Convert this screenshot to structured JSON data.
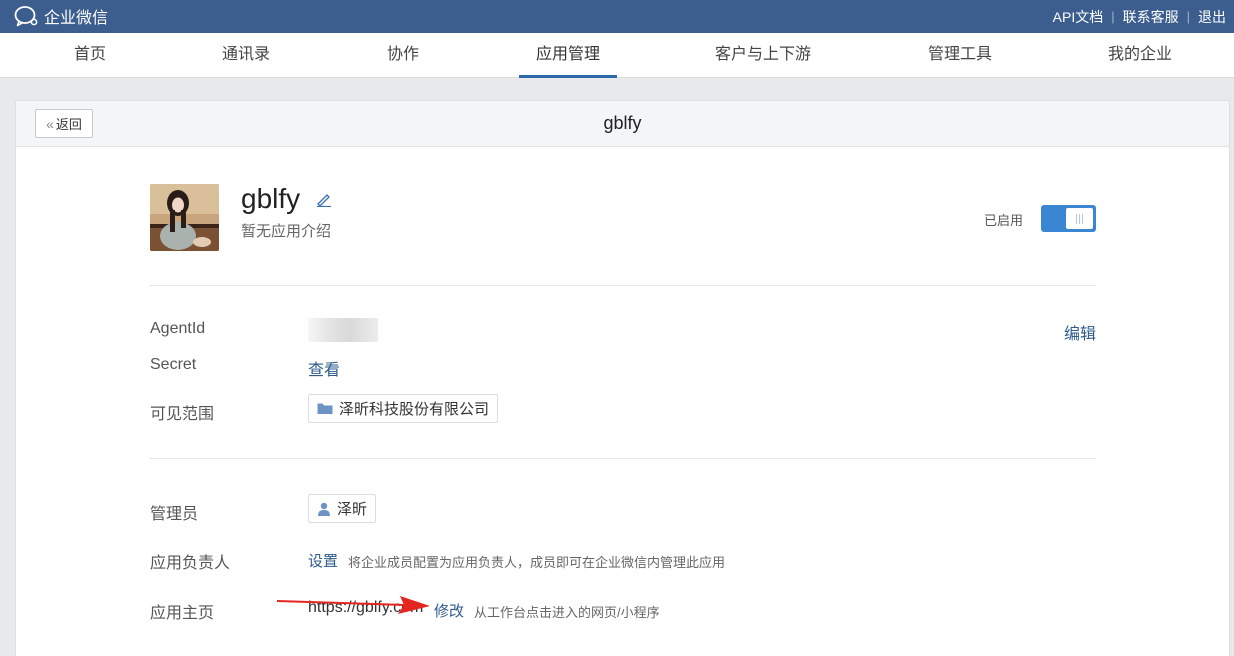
{
  "topbar": {
    "logo_text": "企业微信",
    "links": [
      "API文档",
      "联系客服",
      "退出"
    ]
  },
  "nav": {
    "items": [
      "首页",
      "通讯录",
      "协作",
      "应用管理",
      "客户与上下游",
      "管理工具",
      "我的企业"
    ],
    "active_index": 3
  },
  "panel": {
    "back_label": "返回",
    "title": "gblfy"
  },
  "app": {
    "name": "gblfy",
    "description": "暂无应用介绍",
    "status_label": "已启用",
    "enabled": true
  },
  "details": {
    "agentid_label": "AgentId",
    "edit_link": "编辑",
    "secret_label": "Secret",
    "secret_link": "查看",
    "visible_label": "可见范围",
    "visible_value": "泽昕科技股份有限公司",
    "admin_label": "管理员",
    "admin_value": "泽昕",
    "owner_label": "应用负责人",
    "owner_link": "设置",
    "owner_hint": "将企业成员配置为应用负责人，成员即可在企业微信内管理此应用",
    "homepage_label": "应用主页",
    "homepage_url": "https://gblfy.com",
    "homepage_link": "修改",
    "homepage_hint": "从工作台点击进入的网页/小程序"
  },
  "colors": {
    "topbar": "#3b5e8e",
    "accent": "#2e68a8",
    "toggle": "#3a86d3",
    "link": "#2e5b8c",
    "annotation_arrow": "#e3261f"
  }
}
